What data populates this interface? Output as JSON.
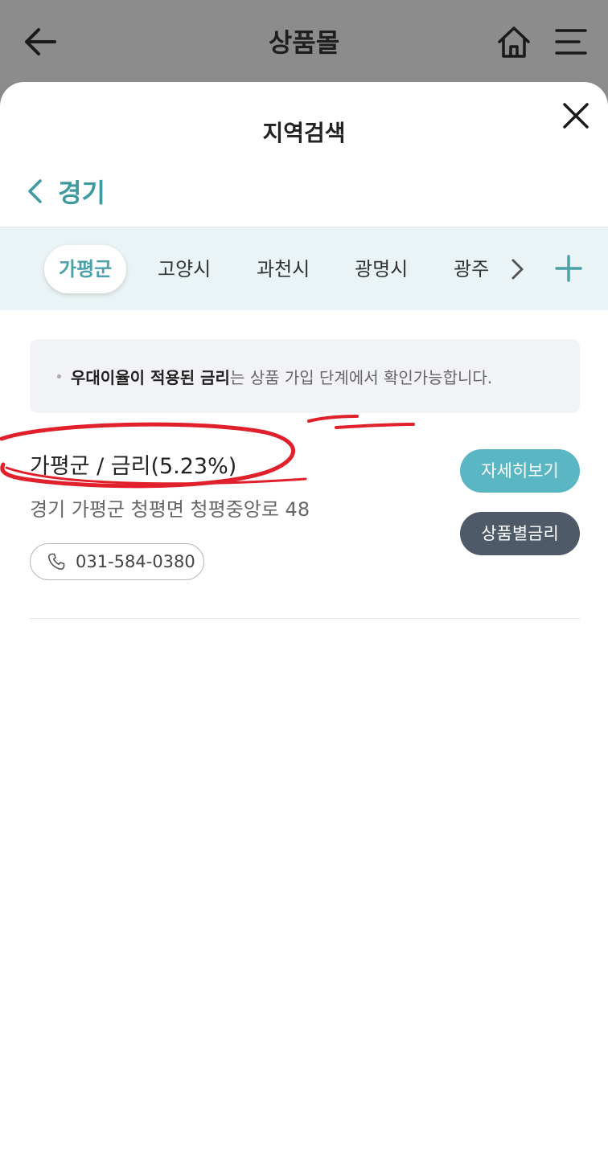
{
  "app_bar": {
    "title": "상품몰"
  },
  "sheet": {
    "title": "지역검색"
  },
  "breadcrumb": {
    "label": "경기"
  },
  "region_tabs": [
    {
      "label": "가평군",
      "active": true
    },
    {
      "label": "고양시",
      "active": false
    },
    {
      "label": "과천시",
      "active": false
    },
    {
      "label": "광명시",
      "active": false
    },
    {
      "label": "광주",
      "active": false
    }
  ],
  "notice": {
    "bold": "우대이율이 적용된 금리",
    "rest": "는 상품 가입 단계에서 확인가능합니다."
  },
  "branch": {
    "title": "가평군 / 금리(5.23%)",
    "address": "경기 가평군 청평면 청평중앙로 48",
    "phone": "031-584-0380",
    "detail_label": "자세히보기",
    "rates_label": "상품별금리"
  },
  "colors": {
    "accent": "#4aa2a8",
    "detail_button": "#5ab6c2",
    "rates_button": "#4f5a68",
    "tab_bar_bg": "#eaf3f5",
    "annotation": "#e0202a"
  },
  "icons": {
    "back": "arrow-left-icon",
    "home": "home-icon",
    "menu": "menu-icon",
    "close": "close-icon",
    "crumb_back": "chevron-left-icon",
    "tab_next": "chevron-right-icon",
    "tab_add": "plus-icon",
    "phone": "phone-icon"
  }
}
